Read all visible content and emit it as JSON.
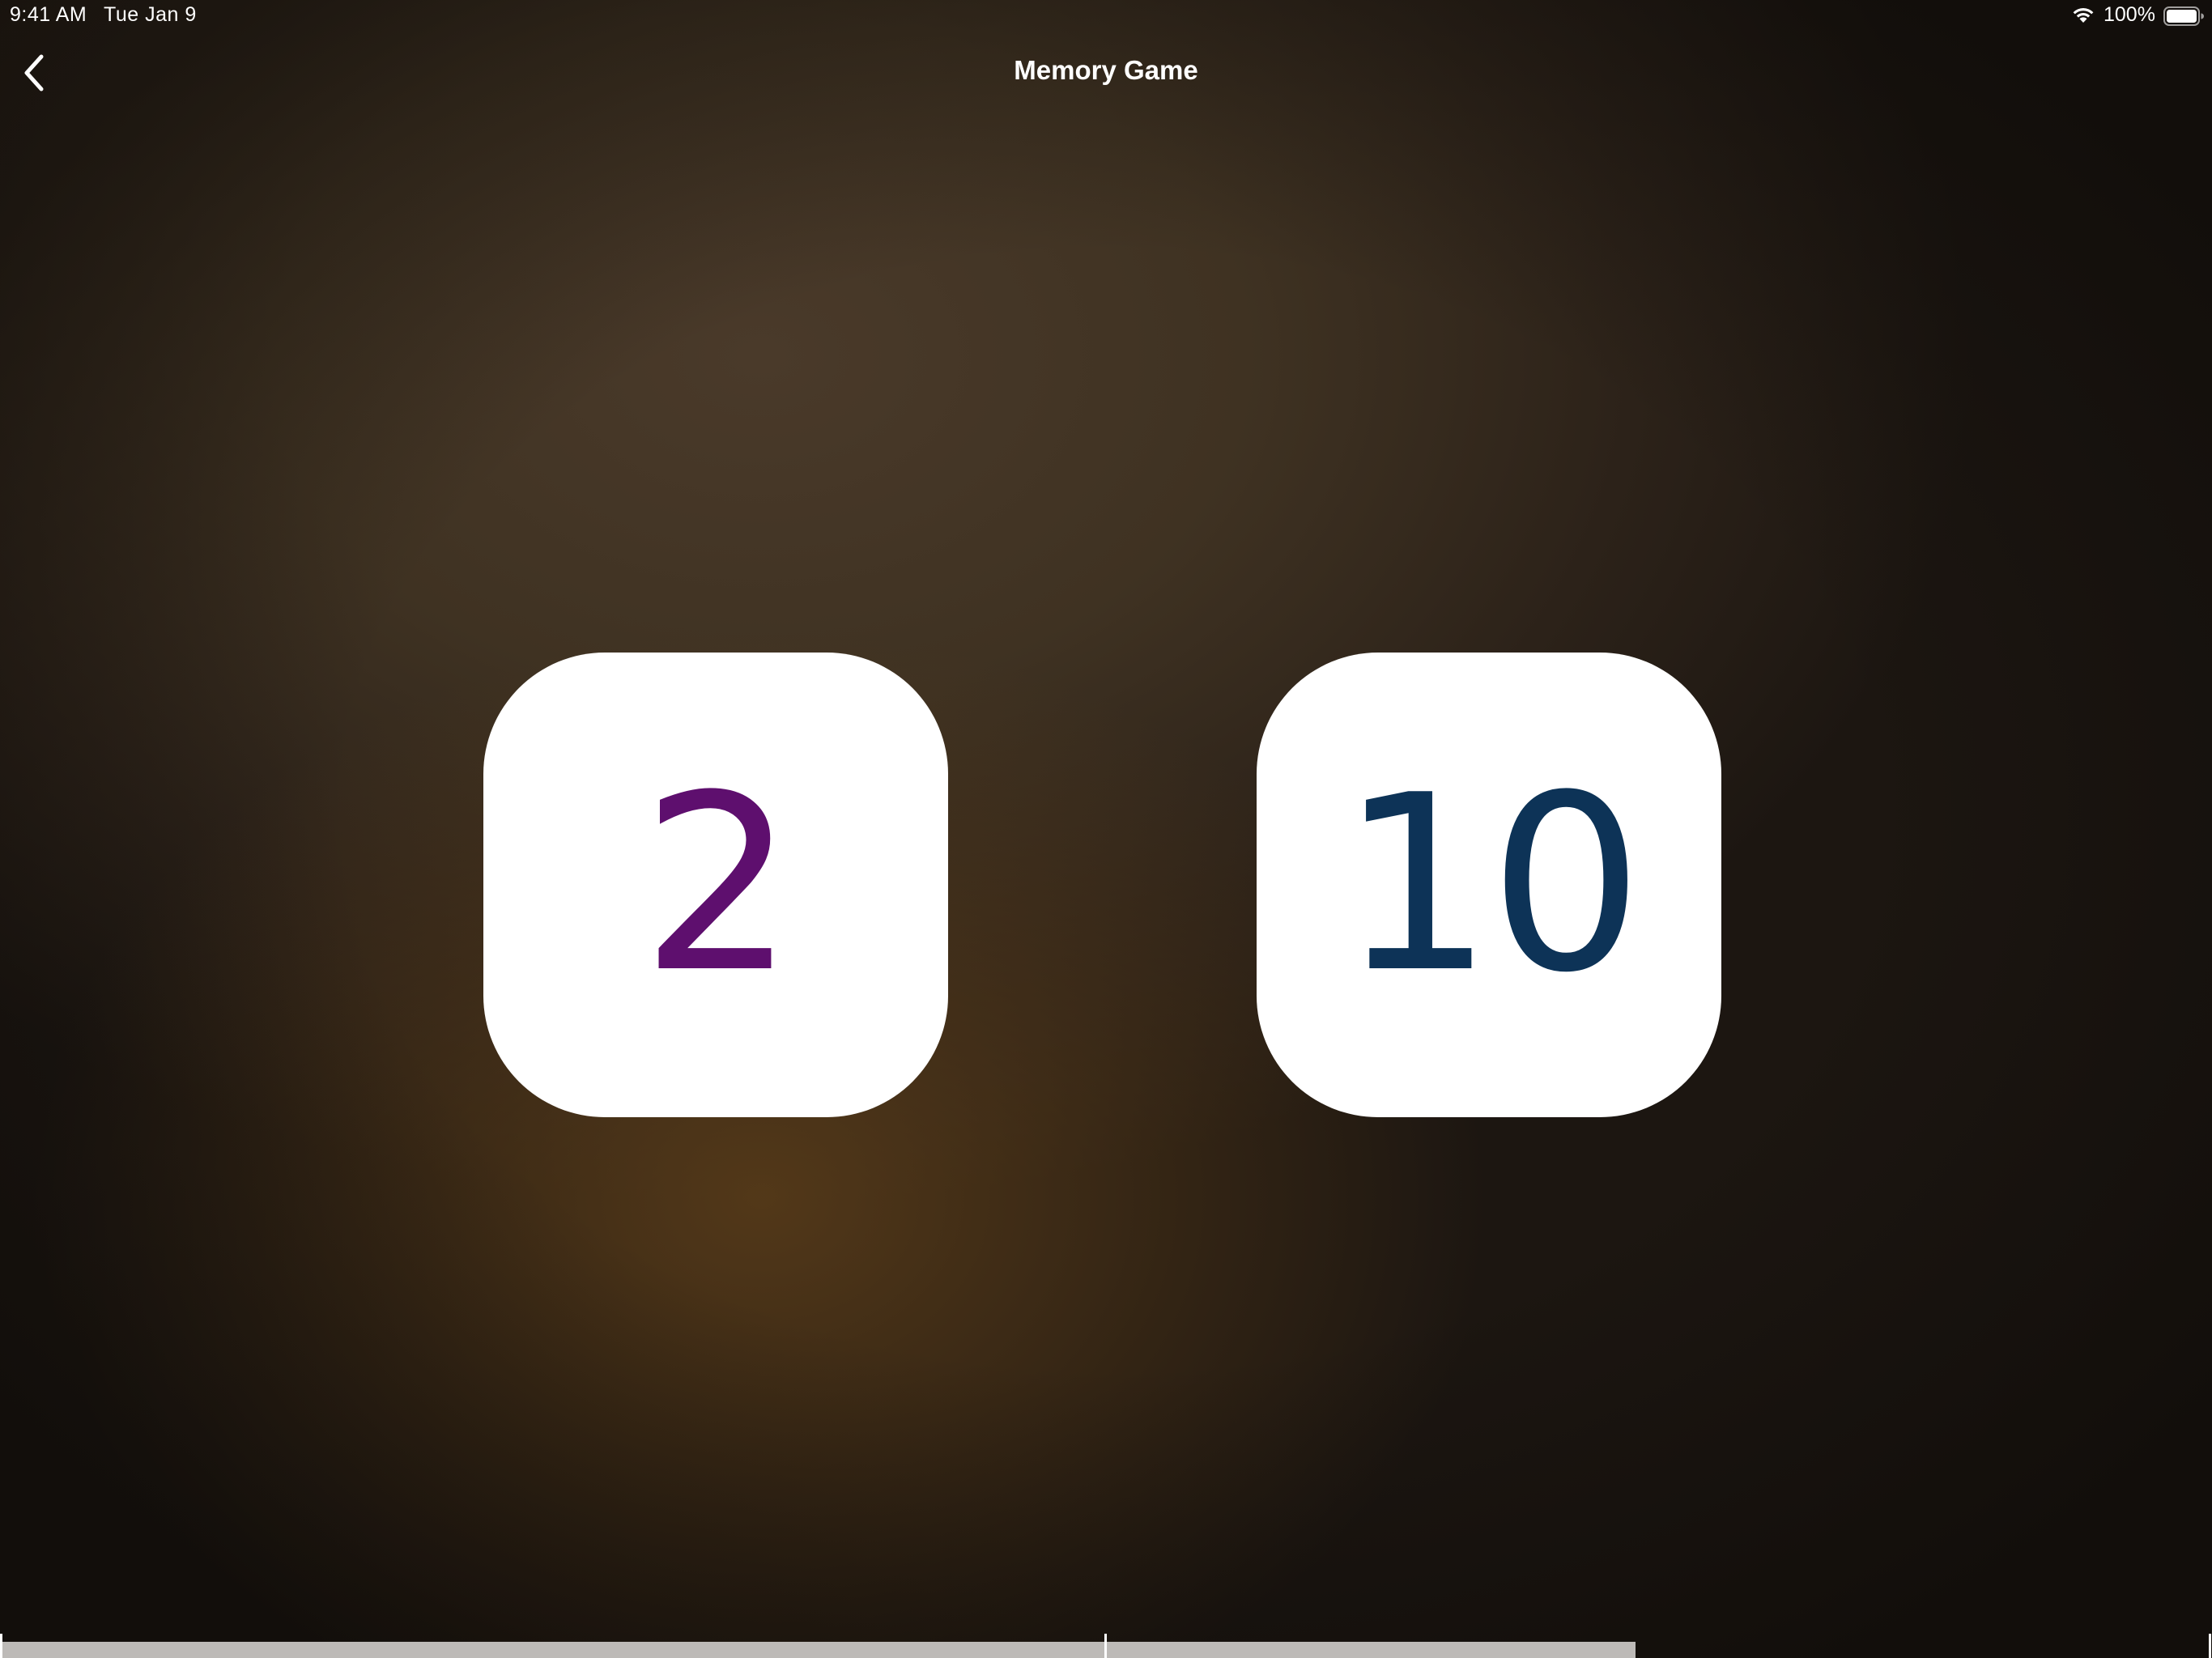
{
  "status_bar": {
    "time": "9:41 AM",
    "date": "Tue Jan 9",
    "battery_percent": "100%",
    "wifi_icon": "wifi-icon",
    "battery_icon": "battery-full-icon"
  },
  "nav": {
    "title": "Memory Game",
    "back_icon": "chevron-left-icon"
  },
  "cards": [
    {
      "value": "2",
      "color": "#5e0f6e"
    },
    {
      "value": "10",
      "color": "#0d3357"
    }
  ],
  "colors": {
    "background_dark": "#1e1812",
    "background_warm": "#4a3a2a",
    "card": "#ffffff",
    "scrubber": "#bdbab7"
  }
}
